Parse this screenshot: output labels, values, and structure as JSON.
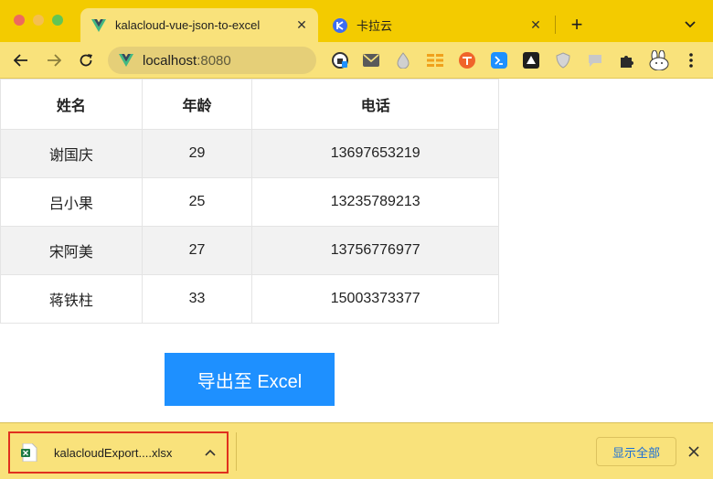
{
  "tabs": [
    {
      "title": "kalacloud-vue-json-to-excel",
      "favicon": "vue-logo-icon",
      "active": true
    },
    {
      "title": "卡拉云",
      "favicon": "kalacloud-logo-icon",
      "active": false
    }
  ],
  "address_bar": {
    "host": "localhost",
    "port": ":8080"
  },
  "table": {
    "headers": [
      "姓名",
      "年龄",
      "电话"
    ],
    "rows": [
      [
        "谢国庆",
        "29",
        "13697653219"
      ],
      [
        "吕小果",
        "25",
        "13235789213"
      ],
      [
        "宋阿美",
        "27",
        "13756776977"
      ],
      [
        "蒋铁柱",
        "33",
        "15003373377"
      ]
    ]
  },
  "export_button": {
    "label": "导出至 Excel"
  },
  "download_shelf": {
    "filename": "kalacloudExport....xlsx",
    "show_all_label": "显示全部"
  },
  "colors": {
    "chrome_yellow": "#f3cb00",
    "toolbar_yellow": "#f9e27b",
    "button_blue": "#1e90ff",
    "highlight_red": "#e0301e"
  }
}
